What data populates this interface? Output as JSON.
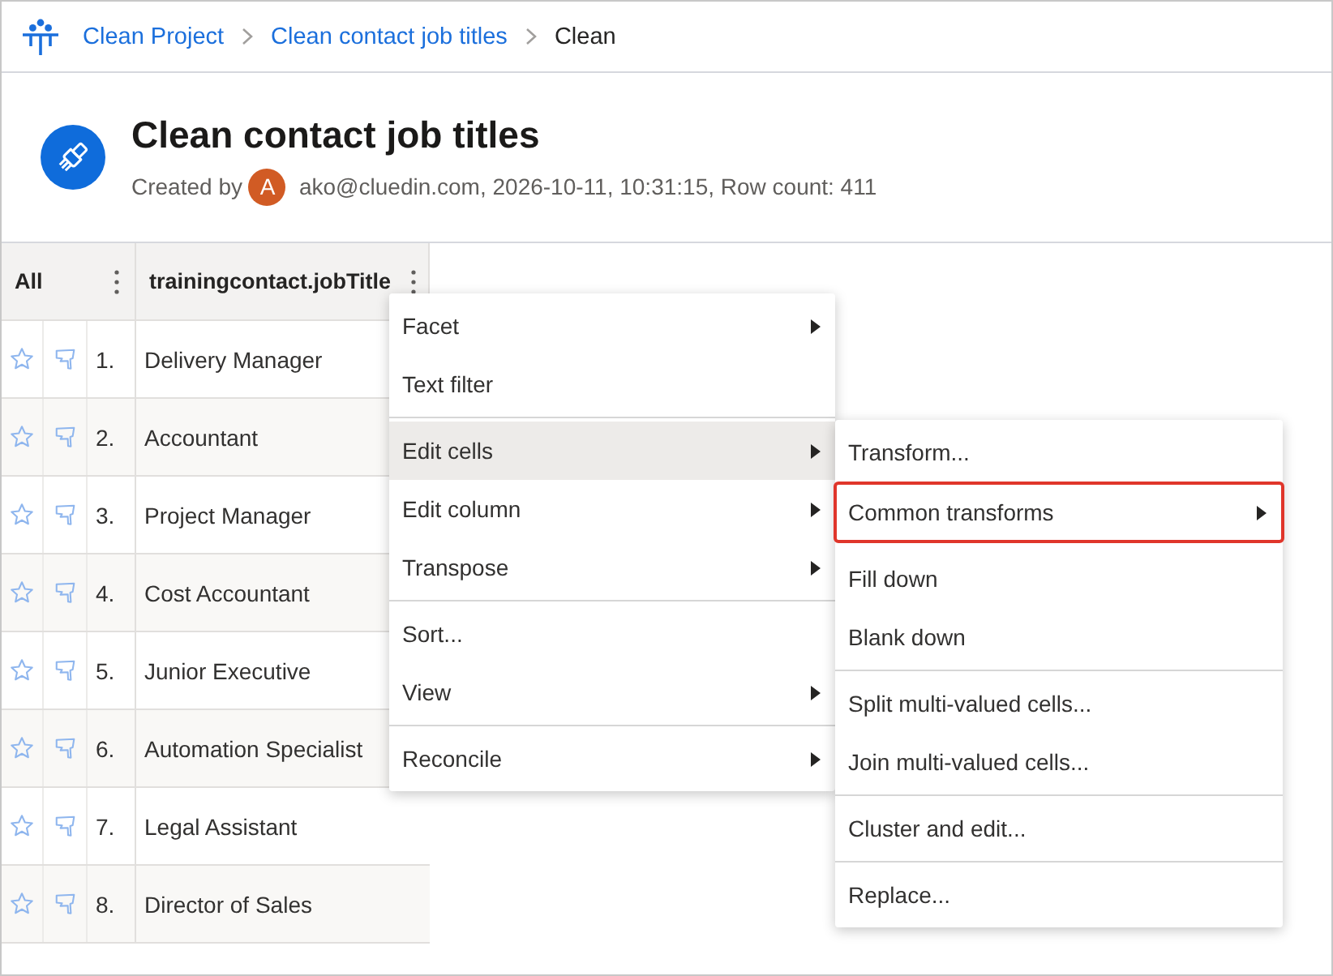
{
  "breadcrumb": [
    {
      "label": "Clean Project",
      "current": false
    },
    {
      "label": "Clean contact job titles",
      "current": false
    },
    {
      "label": "Clean",
      "current": true
    }
  ],
  "header": {
    "title": "Clean contact job titles",
    "created_by_label": "Created by",
    "avatar_initial": "A",
    "meta": "ako@cluedin.com, 2026-10-11, 10:31:15, Row count: 411"
  },
  "table": {
    "columns": [
      {
        "label": "All"
      },
      {
        "label": "trainingcontact.jobTitle"
      }
    ],
    "rows": [
      {
        "number": "1.",
        "value": "Delivery Manager",
        "starred": false,
        "flagged": false
      },
      {
        "number": "2.",
        "value": "Accountant",
        "starred": false,
        "flagged": false
      },
      {
        "number": "3.",
        "value": "Project Manager",
        "starred": false,
        "flagged": false
      },
      {
        "number": "4.",
        "value": "Cost Accountant",
        "starred": false,
        "flagged": false
      },
      {
        "number": "5.",
        "value": "Junior Executive",
        "starred": false,
        "flagged": false
      },
      {
        "number": "6.",
        "value": "Automation Specialist",
        "starred": false,
        "flagged": false
      },
      {
        "number": "7.",
        "value": "Legal Assistant",
        "starred": false,
        "flagged": false
      },
      {
        "number": "8.",
        "value": "Director of Sales",
        "starred": false,
        "flagged": false
      }
    ]
  },
  "context_menu": {
    "groups": [
      {
        "items": [
          {
            "label": "Facet",
            "submenu": true,
            "selected": false
          },
          {
            "label": "Text filter",
            "submenu": false,
            "selected": false
          }
        ]
      },
      {
        "items": [
          {
            "label": "Edit cells",
            "submenu": true,
            "selected": true
          },
          {
            "label": "Edit column",
            "submenu": true,
            "selected": false
          },
          {
            "label": "Transpose",
            "submenu": true,
            "selected": false
          }
        ]
      },
      {
        "items": [
          {
            "label": "Sort...",
            "submenu": false,
            "selected": false
          },
          {
            "label": "View",
            "submenu": true,
            "selected": false
          }
        ]
      },
      {
        "items": [
          {
            "label": "Reconcile",
            "submenu": true,
            "selected": false
          }
        ]
      }
    ]
  },
  "submenu": {
    "groups": [
      {
        "items": [
          {
            "label": "Transform...",
            "submenu": false,
            "selected": false,
            "outlined": false
          },
          {
            "label": "Common transforms",
            "submenu": true,
            "selected": false,
            "outlined": true
          },
          {
            "label": "Fill down",
            "submenu": false,
            "selected": false,
            "outlined": false
          },
          {
            "label": "Blank down",
            "submenu": false,
            "selected": false,
            "outlined": false
          }
        ]
      },
      {
        "items": [
          {
            "label": "Split multi-valued cells...",
            "submenu": false,
            "selected": false,
            "outlined": false
          },
          {
            "label": "Join multi-valued cells...",
            "submenu": false,
            "selected": false,
            "outlined": false
          }
        ]
      },
      {
        "items": [
          {
            "label": "Cluster and edit...",
            "submenu": false,
            "selected": false,
            "outlined": false
          }
        ]
      },
      {
        "items": [
          {
            "label": "Replace...",
            "submenu": false,
            "selected": false,
            "outlined": false
          }
        ]
      }
    ]
  }
}
